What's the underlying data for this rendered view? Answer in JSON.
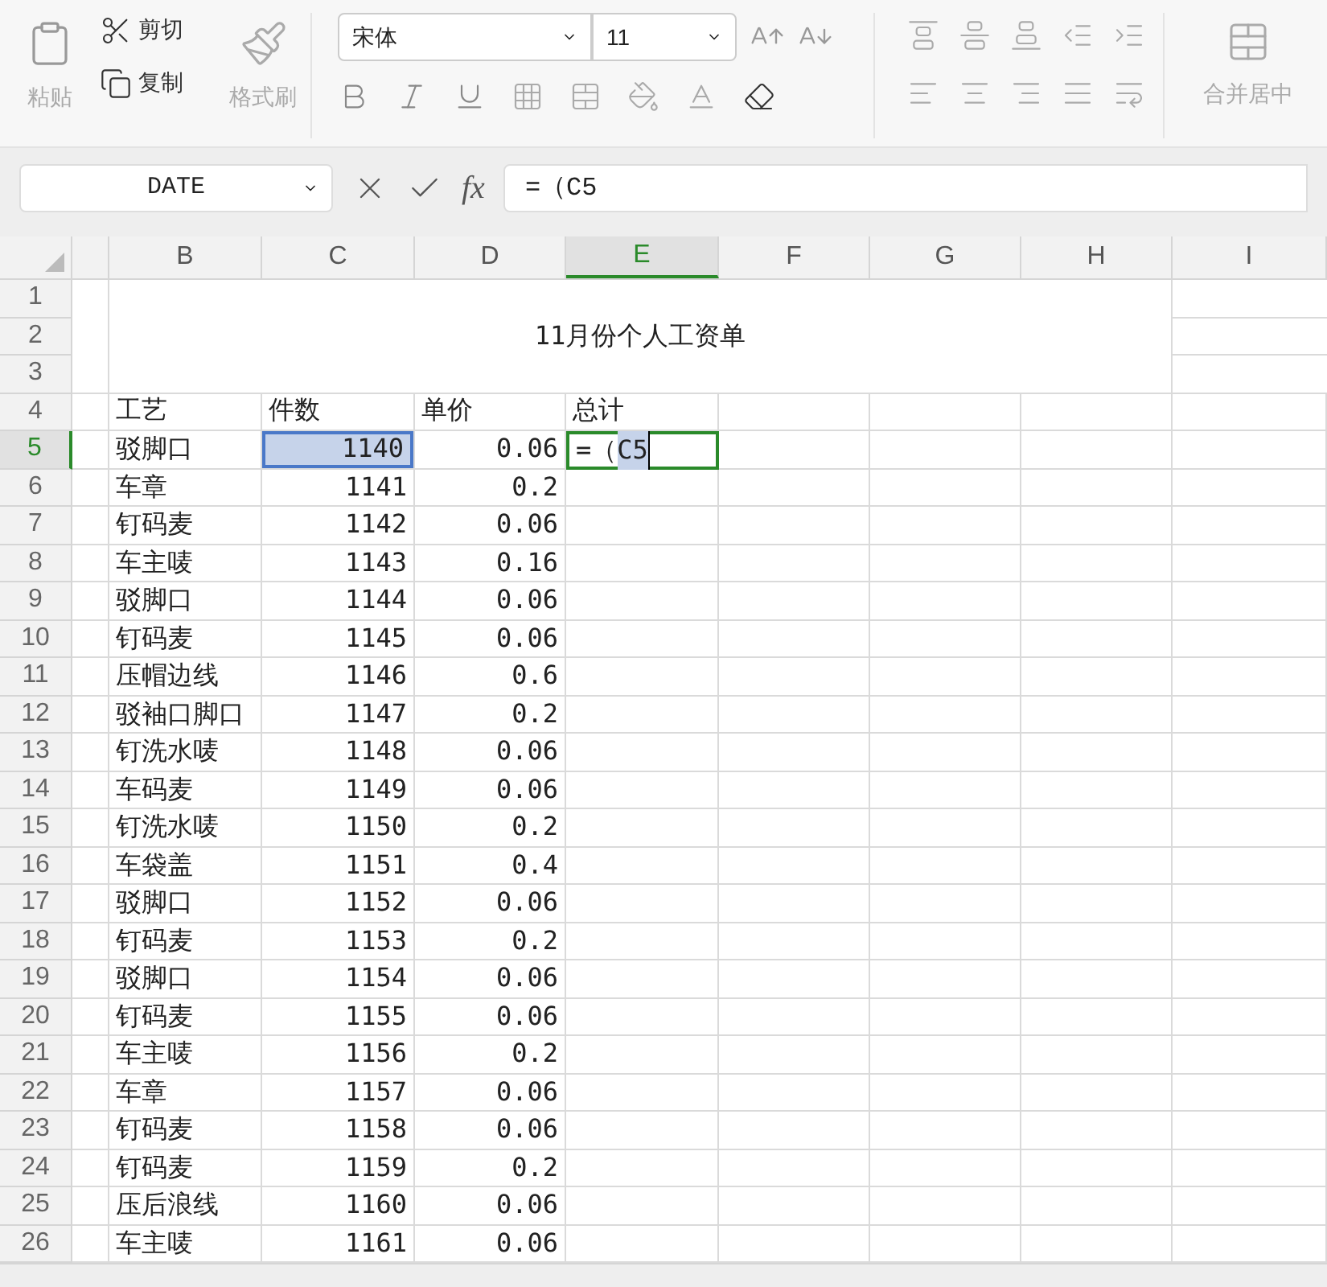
{
  "toolbar": {
    "paste": "粘贴",
    "cut": "剪切",
    "copy": "复制",
    "format_painter": "格式刷",
    "font": "宋体",
    "size": "11",
    "merge": "合并居中"
  },
  "formula_bar": {
    "name_box": "DATE",
    "fx": "fx",
    "formula": "=（C5"
  },
  "columns": [
    {
      "label": "B",
      "selected": false
    },
    {
      "label": "C",
      "selected": false
    },
    {
      "label": "D",
      "selected": false
    },
    {
      "label": "E",
      "selected": true
    },
    {
      "label": "F",
      "selected": false
    },
    {
      "label": "G",
      "selected": false
    },
    {
      "label": "H",
      "selected": false
    },
    {
      "label": "I",
      "selected": false
    }
  ],
  "title": "11月份个人工资单",
  "header_row": [
    "工艺",
    "件数",
    "单价",
    "总计"
  ],
  "editing": {
    "prefix": "=（",
    "ref": "C5"
  },
  "rows": [
    {
      "n": "1"
    },
    {
      "n": "2"
    },
    {
      "n": "3"
    },
    {
      "n": "4"
    },
    {
      "n": "5",
      "b": "驳脚口",
      "c": "1140",
      "d": "0.06",
      "selected": true
    },
    {
      "n": "6",
      "b": "车章",
      "c": "1141",
      "d": "0.2",
      "selected": false
    },
    {
      "n": "7",
      "b": "钉码麦",
      "c": "1142",
      "d": "0.06",
      "selected": false
    },
    {
      "n": "8",
      "b": "车主唛",
      "c": "1143",
      "d": "0.16",
      "selected": false
    },
    {
      "n": "9",
      "b": "驳脚口",
      "c": "1144",
      "d": "0.06",
      "selected": false
    },
    {
      "n": "10",
      "b": "钉码麦",
      "c": "1145",
      "d": "0.06",
      "selected": false
    },
    {
      "n": "11",
      "b": "压帽边线",
      "c": "1146",
      "d": "0.6",
      "selected": false
    },
    {
      "n": "12",
      "b": "驳袖口脚口",
      "c": "1147",
      "d": "0.2",
      "selected": false
    },
    {
      "n": "13",
      "b": "钉洗水唛",
      "c": "1148",
      "d": "0.06",
      "selected": false
    },
    {
      "n": "14",
      "b": "车码麦",
      "c": "1149",
      "d": "0.06",
      "selected": false
    },
    {
      "n": "15",
      "b": "钉洗水唛",
      "c": "1150",
      "d": "0.2",
      "selected": false
    },
    {
      "n": "16",
      "b": "车袋盖",
      "c": "1151",
      "d": "0.4",
      "selected": false
    },
    {
      "n": "17",
      "b": "驳脚口",
      "c": "1152",
      "d": "0.06",
      "selected": false
    },
    {
      "n": "18",
      "b": "钉码麦",
      "c": "1153",
      "d": "0.2",
      "selected": false
    },
    {
      "n": "19",
      "b": "驳脚口",
      "c": "1154",
      "d": "0.06",
      "selected": false
    },
    {
      "n": "20",
      "b": "钉码麦",
      "c": "1155",
      "d": "0.06",
      "selected": false
    },
    {
      "n": "21",
      "b": "车主唛",
      "c": "1156",
      "d": "0.2",
      "selected": false
    },
    {
      "n": "22",
      "b": "车章",
      "c": "1157",
      "d": "0.06",
      "selected": false
    },
    {
      "n": "23",
      "b": "钉码麦",
      "c": "1158",
      "d": "0.06",
      "selected": false
    },
    {
      "n": "24",
      "b": "钉码麦",
      "c": "1159",
      "d": "0.2",
      "selected": false
    },
    {
      "n": "25",
      "b": "压后浪线",
      "c": "1160",
      "d": "0.06",
      "selected": false
    },
    {
      "n": "26",
      "b": "车主唛",
      "c": "1161",
      "d": "0.06",
      "selected": false
    }
  ]
}
